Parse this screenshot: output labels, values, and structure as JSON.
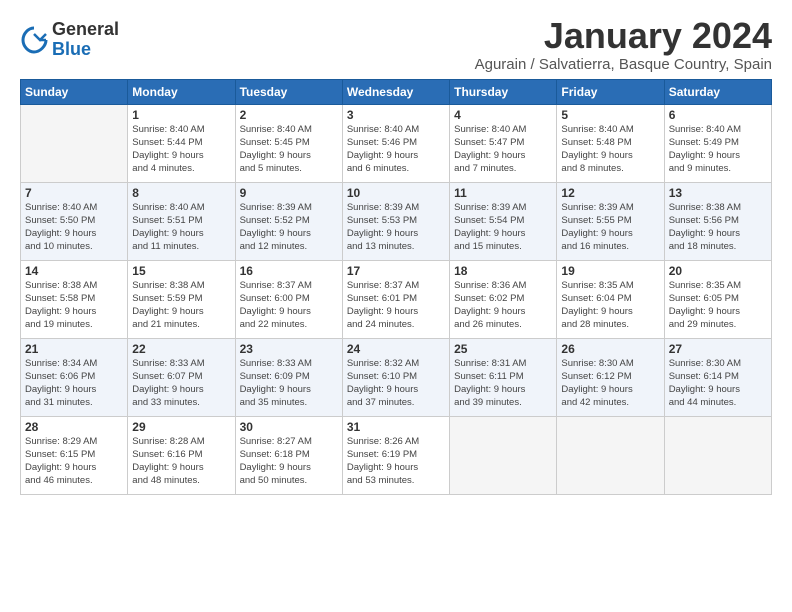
{
  "logo": {
    "general": "General",
    "blue": "Blue"
  },
  "title": "January 2024",
  "subtitle": "Agurain / Salvatierra, Basque Country, Spain",
  "headers": [
    "Sunday",
    "Monday",
    "Tuesday",
    "Wednesday",
    "Thursday",
    "Friday",
    "Saturday"
  ],
  "weeks": [
    [
      {
        "day": "",
        "info": ""
      },
      {
        "day": "1",
        "info": "Sunrise: 8:40 AM\nSunset: 5:44 PM\nDaylight: 9 hours\nand 4 minutes."
      },
      {
        "day": "2",
        "info": "Sunrise: 8:40 AM\nSunset: 5:45 PM\nDaylight: 9 hours\nand 5 minutes."
      },
      {
        "day": "3",
        "info": "Sunrise: 8:40 AM\nSunset: 5:46 PM\nDaylight: 9 hours\nand 6 minutes."
      },
      {
        "day": "4",
        "info": "Sunrise: 8:40 AM\nSunset: 5:47 PM\nDaylight: 9 hours\nand 7 minutes."
      },
      {
        "day": "5",
        "info": "Sunrise: 8:40 AM\nSunset: 5:48 PM\nDaylight: 9 hours\nand 8 minutes."
      },
      {
        "day": "6",
        "info": "Sunrise: 8:40 AM\nSunset: 5:49 PM\nDaylight: 9 hours\nand 9 minutes."
      }
    ],
    [
      {
        "day": "7",
        "info": "Sunrise: 8:40 AM\nSunset: 5:50 PM\nDaylight: 9 hours\nand 10 minutes."
      },
      {
        "day": "8",
        "info": "Sunrise: 8:40 AM\nSunset: 5:51 PM\nDaylight: 9 hours\nand 11 minutes."
      },
      {
        "day": "9",
        "info": "Sunrise: 8:39 AM\nSunset: 5:52 PM\nDaylight: 9 hours\nand 12 minutes."
      },
      {
        "day": "10",
        "info": "Sunrise: 8:39 AM\nSunset: 5:53 PM\nDaylight: 9 hours\nand 13 minutes."
      },
      {
        "day": "11",
        "info": "Sunrise: 8:39 AM\nSunset: 5:54 PM\nDaylight: 9 hours\nand 15 minutes."
      },
      {
        "day": "12",
        "info": "Sunrise: 8:39 AM\nSunset: 5:55 PM\nDaylight: 9 hours\nand 16 minutes."
      },
      {
        "day": "13",
        "info": "Sunrise: 8:38 AM\nSunset: 5:56 PM\nDaylight: 9 hours\nand 18 minutes."
      }
    ],
    [
      {
        "day": "14",
        "info": "Sunrise: 8:38 AM\nSunset: 5:58 PM\nDaylight: 9 hours\nand 19 minutes."
      },
      {
        "day": "15",
        "info": "Sunrise: 8:38 AM\nSunset: 5:59 PM\nDaylight: 9 hours\nand 21 minutes."
      },
      {
        "day": "16",
        "info": "Sunrise: 8:37 AM\nSunset: 6:00 PM\nDaylight: 9 hours\nand 22 minutes."
      },
      {
        "day": "17",
        "info": "Sunrise: 8:37 AM\nSunset: 6:01 PM\nDaylight: 9 hours\nand 24 minutes."
      },
      {
        "day": "18",
        "info": "Sunrise: 8:36 AM\nSunset: 6:02 PM\nDaylight: 9 hours\nand 26 minutes."
      },
      {
        "day": "19",
        "info": "Sunrise: 8:35 AM\nSunset: 6:04 PM\nDaylight: 9 hours\nand 28 minutes."
      },
      {
        "day": "20",
        "info": "Sunrise: 8:35 AM\nSunset: 6:05 PM\nDaylight: 9 hours\nand 29 minutes."
      }
    ],
    [
      {
        "day": "21",
        "info": "Sunrise: 8:34 AM\nSunset: 6:06 PM\nDaylight: 9 hours\nand 31 minutes."
      },
      {
        "day": "22",
        "info": "Sunrise: 8:33 AM\nSunset: 6:07 PM\nDaylight: 9 hours\nand 33 minutes."
      },
      {
        "day": "23",
        "info": "Sunrise: 8:33 AM\nSunset: 6:09 PM\nDaylight: 9 hours\nand 35 minutes."
      },
      {
        "day": "24",
        "info": "Sunrise: 8:32 AM\nSunset: 6:10 PM\nDaylight: 9 hours\nand 37 minutes."
      },
      {
        "day": "25",
        "info": "Sunrise: 8:31 AM\nSunset: 6:11 PM\nDaylight: 9 hours\nand 39 minutes."
      },
      {
        "day": "26",
        "info": "Sunrise: 8:30 AM\nSunset: 6:12 PM\nDaylight: 9 hours\nand 42 minutes."
      },
      {
        "day": "27",
        "info": "Sunrise: 8:30 AM\nSunset: 6:14 PM\nDaylight: 9 hours\nand 44 minutes."
      }
    ],
    [
      {
        "day": "28",
        "info": "Sunrise: 8:29 AM\nSunset: 6:15 PM\nDaylight: 9 hours\nand 46 minutes."
      },
      {
        "day": "29",
        "info": "Sunrise: 8:28 AM\nSunset: 6:16 PM\nDaylight: 9 hours\nand 48 minutes."
      },
      {
        "day": "30",
        "info": "Sunrise: 8:27 AM\nSunset: 6:18 PM\nDaylight: 9 hours\nand 50 minutes."
      },
      {
        "day": "31",
        "info": "Sunrise: 8:26 AM\nSunset: 6:19 PM\nDaylight: 9 hours\nand 53 minutes."
      },
      {
        "day": "",
        "info": ""
      },
      {
        "day": "",
        "info": ""
      },
      {
        "day": "",
        "info": ""
      }
    ]
  ]
}
